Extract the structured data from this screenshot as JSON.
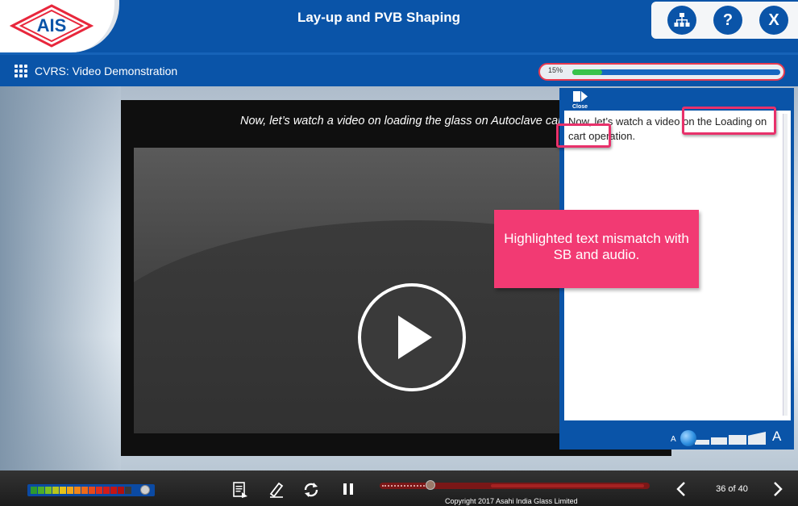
{
  "header": {
    "logo_text": "AIS",
    "title": "Lay-up and PVB Shaping",
    "buttons": {
      "sitemap_icon": "sitemap-icon",
      "help_label": "?",
      "close_label": "X"
    }
  },
  "subheader": {
    "module_title": "CVRS: Video Demonstration",
    "progress": {
      "label": "15%",
      "fraction": 0.15
    }
  },
  "video": {
    "caption": "Now, let’s watch a video on loading the glass on Autoclave cart operation.",
    "play_icon": "play-icon"
  },
  "transcript": {
    "close_label": "Close",
    "text": "Now, let’s watch a video on the Loading on cart operation.",
    "font_small_label": "A",
    "font_large_label": "A"
  },
  "annotation": {
    "callout_text": "Highlighted text mismatch with SB and audio.",
    "color": "#f23a73"
  },
  "footer": {
    "volume_level": 0.92,
    "controls": [
      "transcript-icon",
      "edit-icon",
      "replay-icon",
      "pause-icon"
    ],
    "seek_fraction": 0.19,
    "page_counter": "36 of 40",
    "copyright": "Copyright 2017 Asahi India Glass Limited"
  },
  "colors": {
    "brand_blue": "#0a54a8",
    "accent_pink": "#e8316b",
    "progress_green": "#39c34a"
  }
}
